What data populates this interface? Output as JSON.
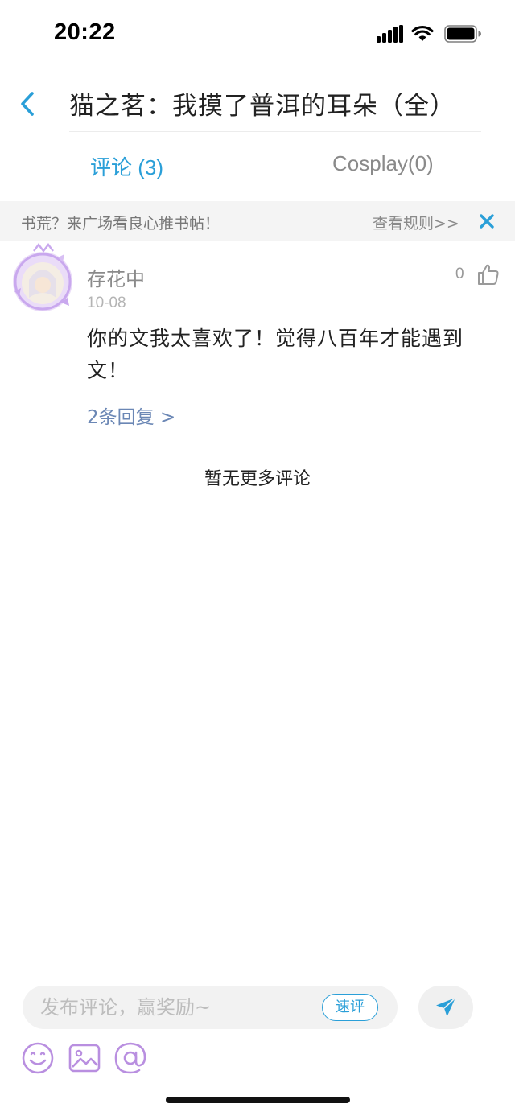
{
  "status_bar": {
    "time": "20:22"
  },
  "nav": {
    "title": "猫之茗：我摸了普洱的耳朵（全）"
  },
  "tabs": [
    {
      "label": "评论 (3)",
      "active": true
    },
    {
      "label": "Cosplay(0)",
      "active": false
    }
  ],
  "notice": {
    "text": "书荒？来广场看良心推书帖！",
    "rules_link": "查看规则>>"
  },
  "comments": [
    {
      "user": "存花中",
      "date": "10-08",
      "likes": "0",
      "body": "你的文我太喜欢了！觉得八百年才能遇到文！",
      "replies_link": "2条回复 >"
    }
  ],
  "no_more_text": "暂无更多评论",
  "composer": {
    "placeholder": "发布评论，赢奖励~",
    "quick_comment_label": "速评"
  },
  "colors": {
    "accent": "#2a9fd8",
    "reply_link": "#6b87b5",
    "icon_purple": "#b98fe0"
  },
  "icons": [
    "back-icon",
    "signal-icon",
    "wifi-icon",
    "battery-icon",
    "close-icon",
    "thumb-up-icon",
    "send-icon",
    "emoji-icon",
    "image-icon",
    "at-icon"
  ]
}
